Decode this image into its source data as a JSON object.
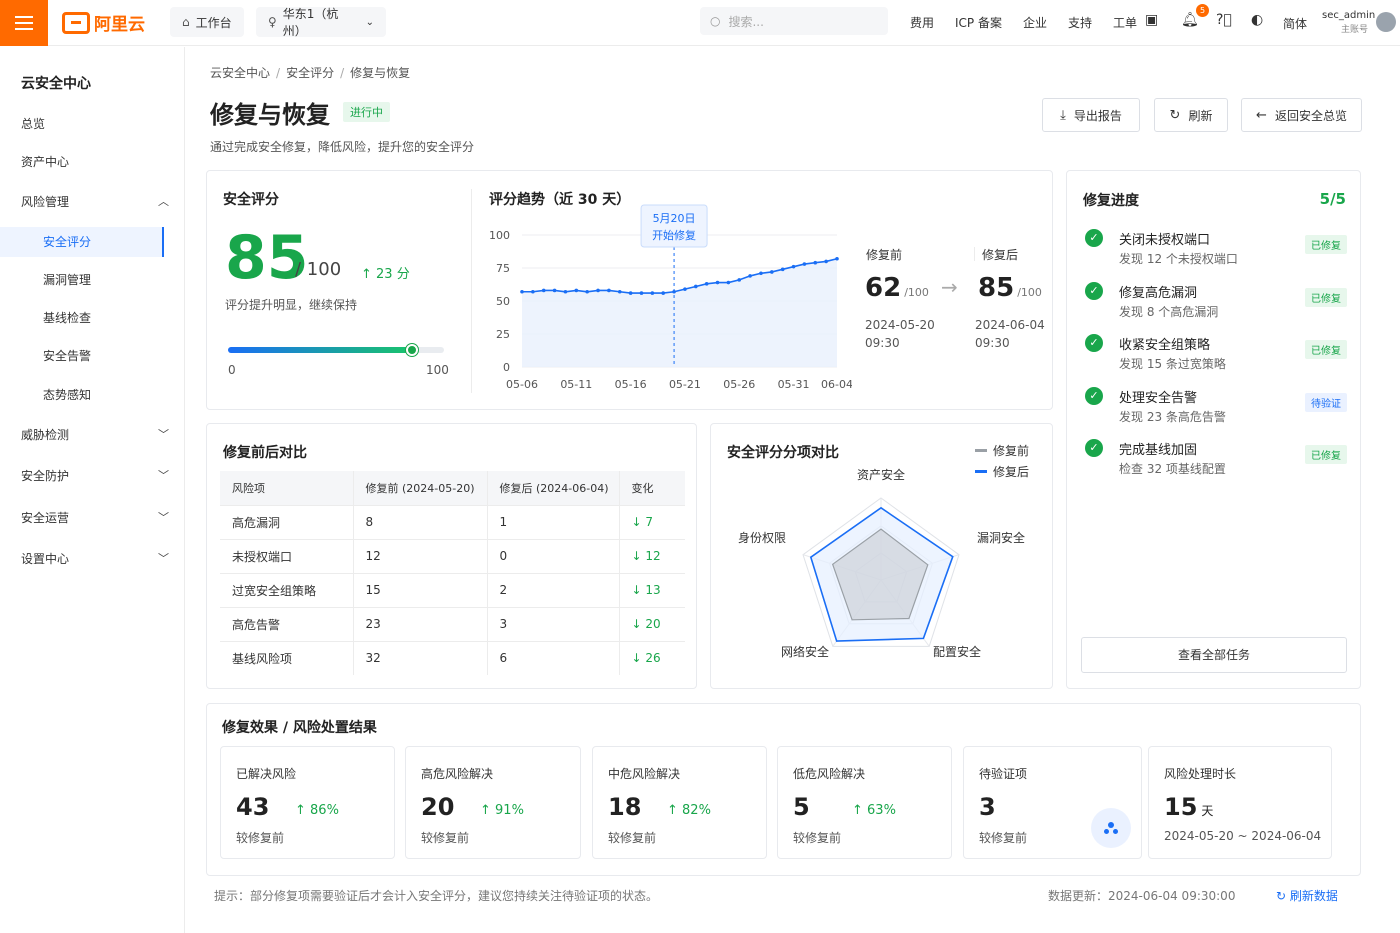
{
  "topbar": {
    "logo_text": "阿里云",
    "workbench": "工作台",
    "region": "华东1（杭州）",
    "search_placeholder": "搜索...",
    "links": [
      "费用",
      "ICP 备案",
      "企业",
      "支持",
      "工单"
    ],
    "notification_count": "5",
    "lang": "简体",
    "user_name": "sec_admin",
    "user_role": "主账号"
  },
  "sidebar": {
    "title": "云安全中心",
    "items": [
      "总览",
      "资产中心",
      "风险管理",
      "安全评分",
      "漏洞管理",
      "基线检查",
      "安全告警",
      "态势感知",
      "威胁检测",
      "安全防护",
      "安全运营",
      "设置中心"
    ]
  },
  "header": {
    "breadcrumb": [
      "云安全中心",
      "安全评分",
      "修复与恢复"
    ],
    "title": "修复与恢复",
    "status": "进行中",
    "subtitle": "通过完成安全修复，降低风险，提升您的安全评分",
    "btn_export": "导出报告",
    "btn_refresh": "刷新",
    "btn_back": "返回安全总览"
  },
  "score": {
    "title": "安全评分",
    "value": "85",
    "max": "/ 100",
    "increase": "↑ 23 分",
    "note": "评分提升明显，继续保持",
    "progress": 0.85,
    "min_label": "0",
    "max_label": "100"
  },
  "trend": {
    "title": "评分趋势（近 30 天）",
    "annotation_date": "5月20日",
    "annotation_text": "开始修复",
    "before_label": "修复前",
    "before_value": "62",
    "before_unit": "/100",
    "before_date": "2024-05-20",
    "before_time": "09:30",
    "after_label": "修复后",
    "after_value": "85",
    "after_unit": "/100",
    "after_date": "2024-06-04",
    "after_time": "09:30"
  },
  "chart_data": {
    "type": "area",
    "x_ticks": [
      "05-06",
      "05-11",
      "05-16",
      "05-21",
      "05-26",
      "05-31",
      "06-04"
    ],
    "y_ticks": [
      0,
      25,
      50,
      75,
      100
    ],
    "ylim": [
      0,
      100
    ],
    "x": [
      "05-06",
      "05-07",
      "05-08",
      "05-09",
      "05-10",
      "05-11",
      "05-12",
      "05-13",
      "05-14",
      "05-15",
      "05-16",
      "05-17",
      "05-18",
      "05-19",
      "05-20",
      "05-21",
      "05-22",
      "05-23",
      "05-24",
      "05-25",
      "05-26",
      "05-27",
      "05-28",
      "05-29",
      "05-30",
      "05-31",
      "06-01",
      "06-02",
      "06-03",
      "06-04"
    ],
    "values": [
      57,
      57,
      58,
      58,
      57,
      58,
      57,
      58,
      58,
      57,
      56,
      56,
      56,
      56,
      57,
      59,
      61,
      63,
      64,
      64,
      66,
      69,
      71,
      72,
      74,
      76,
      78,
      79,
      80,
      82
    ],
    "grid": true,
    "marker": "05-20"
  },
  "comparison": {
    "title": "修复前后对比",
    "headers": [
      "风险项",
      "修复前 (2024-05-20)",
      "修复后 (2024-06-04)",
      "变化"
    ],
    "rows": [
      [
        "高危漏洞",
        "8",
        "1",
        "↓ 7"
      ],
      [
        "未授权端口",
        "12",
        "0",
        "↓ 12"
      ],
      [
        "过宽安全组策略",
        "15",
        "2",
        "↓ 13"
      ],
      [
        "高危告警",
        "23",
        "3",
        "↓ 20"
      ],
      [
        "基线风险项",
        "32",
        "6",
        "↓ 26"
      ]
    ]
  },
  "radar": {
    "title": "安全评分分项对比",
    "legend_before": "修复前",
    "legend_after": "修复后",
    "axes": [
      "资产安全",
      "漏洞安全",
      "配置安全",
      "网络安全",
      "身份权限"
    ],
    "before": [
      0.62,
      0.6,
      0.58,
      0.6,
      0.62
    ],
    "after": [
      0.88,
      0.92,
      0.88,
      0.92,
      0.9
    ],
    "before_color": "#9aa0a6",
    "after_color": "#1a6ef5"
  },
  "progress": {
    "title": "修复进度",
    "count": "5/5",
    "tasks": [
      {
        "title": "关闭未授权端口",
        "desc": "发现 12 个未授权端口",
        "tag": "已修复"
      },
      {
        "title": "修复高危漏洞",
        "desc": "发现 8 个高危漏洞",
        "tag": "已修复"
      },
      {
        "title": "收紧安全组策略",
        "desc": "发现 15 条过宽策略",
        "tag": "已修复"
      },
      {
        "title": "处理安全告警",
        "desc": "发现 23 条高危告警",
        "tag": "待验证"
      },
      {
        "title": "完成基线加固",
        "desc": "检查 32 项基线配置",
        "tag": "已修复"
      }
    ],
    "view_all": "查看全部任务"
  },
  "results": {
    "title": "修复效果 / 风险处置结果",
    "cards": [
      {
        "label": "已解决风险",
        "value": "43",
        "pct": "↑ 86%",
        "sub": "较修复前"
      },
      {
        "label": "高危风险解决",
        "value": "20",
        "pct": "↑ 91%",
        "sub": "较修复前"
      },
      {
        "label": "中危风险解决",
        "value": "18",
        "pct": "↑ 82%",
        "sub": "较修复前"
      },
      {
        "label": "低危风险解决",
        "value": "5",
        "pct": "↑ 63%",
        "sub": "较修复前"
      },
      {
        "label": "待验证项",
        "value": "3",
        "pct": "",
        "sub": "较修复前"
      },
      {
        "label": "风险处理时长",
        "value": "15",
        "unit": "天",
        "pct": "",
        "sub": "2024-05-20 ~ 2024-06-04"
      }
    ]
  },
  "footer": {
    "note": "提示：部分修复项需要验证后才会计入安全评分，建议您持续关注待验证项的状态。",
    "updated": "数据更新：2024-06-04 09:30:00",
    "refresh": "刷新数据"
  },
  "colors": {
    "brand": "#ff6a00",
    "accent": "#1a6ef5",
    "success": "#19a64b"
  }
}
